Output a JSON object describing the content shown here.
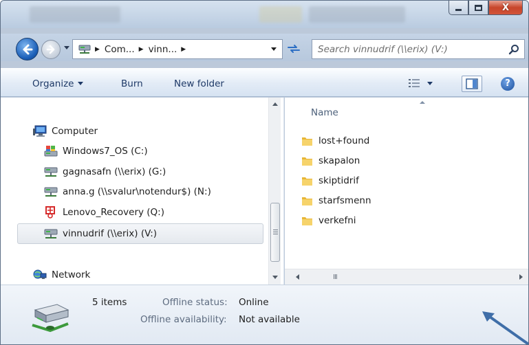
{
  "titlebar": {
    "caption_buttons": {
      "minimize_icon": "minimize-icon",
      "maximize_icon": "maximize-icon",
      "close_label": "X"
    }
  },
  "address": {
    "crumbs": [
      "Com...",
      "vinn..."
    ],
    "search_placeholder": "Search vinnudrif (\\\\erix) (V:)"
  },
  "toolbar": {
    "organize": "Organize",
    "burn": "Burn",
    "new_folder": "New folder",
    "help": "?"
  },
  "navigation": {
    "computer": "Computer",
    "drives": [
      {
        "label": "Windows7_OS (C:)",
        "icon": "os-drive-icon"
      },
      {
        "label": "gagnasafn (\\\\erix) (G:)",
        "icon": "network-drive-icon"
      },
      {
        "label": "anna.g (\\\\svalur\\notendur$) (N:)",
        "icon": "network-drive-icon"
      },
      {
        "label": "Lenovo_Recovery (Q:)",
        "icon": "recovery-drive-icon"
      },
      {
        "label": "vinnudrif (\\\\erix) (V:)",
        "icon": "network-drive-icon",
        "selected": true
      }
    ],
    "network": "Network"
  },
  "filelist": {
    "column_name": "Name",
    "items": [
      "lost+found",
      "skapalon",
      "skiptidrif",
      "starfsmenn",
      "verkefni"
    ],
    "hscroll_grip": "III"
  },
  "details": {
    "item_count": "5 items",
    "offline_status_label": "Offline status:",
    "offline_status_value": "Online",
    "offline_availability_label": "Offline availability:",
    "offline_availability_value": "Not available"
  },
  "colors": {
    "toolbar_text": "#1e3967",
    "accent_blue": "#1b5fb8",
    "annotation_arrow": "#3f6ea8"
  }
}
